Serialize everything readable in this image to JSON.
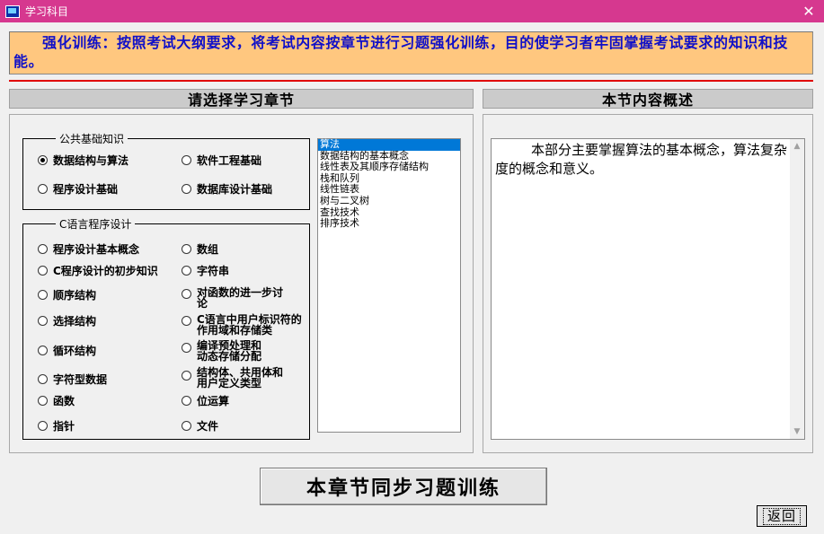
{
  "window": {
    "title": "学习科目",
    "close_glyph": "✕"
  },
  "banner": {
    "text": "强化训练：按照考试大纲要求，将考试内容按章节进行习题强化训练，目的使学习者牢固掌握考试要求的知识和技能。"
  },
  "left_header": "请选择学习章节",
  "right_header": "本节内容概述",
  "group_basic": {
    "title": "公共基础知识",
    "options": [
      "数据结构与算法",
      "软件工程基础",
      "程序设计基础",
      "数据库设计基础"
    ],
    "selected": "数据结构与算法"
  },
  "group_c": {
    "title": "C语言程序设计",
    "options": [
      "程序设计基本概念",
      "数组",
      "C程序设计的初步知识",
      "字符串",
      "顺序结构",
      "对函数的进一步讨论",
      "选择结构",
      "C语言中用户标识符的作用域和存储类",
      "循环结构",
      "编译预处理和动态存储分配",
      "字符型数据",
      "结构体、共用体和用户定义类型",
      "函数",
      "位运算",
      "指针",
      "文件"
    ]
  },
  "listbox": {
    "items": [
      "算法",
      "数据结构的基本概念",
      "线性表及其顺序存储结构",
      "栈和队列",
      "线性链表",
      "树与二叉树",
      "查找技术",
      "排序技术"
    ],
    "selected_index": 0
  },
  "summary": {
    "text": "本部分主要掌握算法的基本概念，算法复杂度的概念和意义。"
  },
  "buttons": {
    "train": "本章节同步习题训练",
    "back": "返回"
  },
  "colors": {
    "titlebar": "#d6388f",
    "banner_bg": "#ffc77f",
    "banner_text": "#1010c8",
    "divider": "#e00000",
    "selection": "#0078d7"
  }
}
